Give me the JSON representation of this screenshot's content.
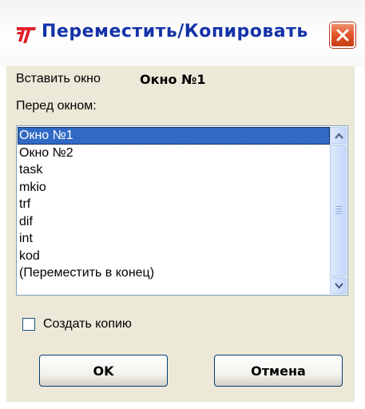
{
  "window": {
    "title": "Переместить/Копировать"
  },
  "insert": {
    "label": "Вставить окно",
    "window_name": "Окно №1"
  },
  "before": {
    "label": "Перед окном:"
  },
  "list": {
    "items": [
      "Окно №1",
      "Окно №2",
      "task",
      "mkio",
      "trf",
      "dif",
      "int",
      "kod",
      "(Переместить в конец)"
    ],
    "selected_index": 0
  },
  "copy": {
    "label": "Создать копию",
    "checked": false
  },
  "buttons": {
    "ok": "OK",
    "cancel": "Отмена"
  },
  "colors": {
    "title_text": "#1433a8",
    "selection": "#316ac5",
    "dialog_bg": "#ece9d8"
  }
}
